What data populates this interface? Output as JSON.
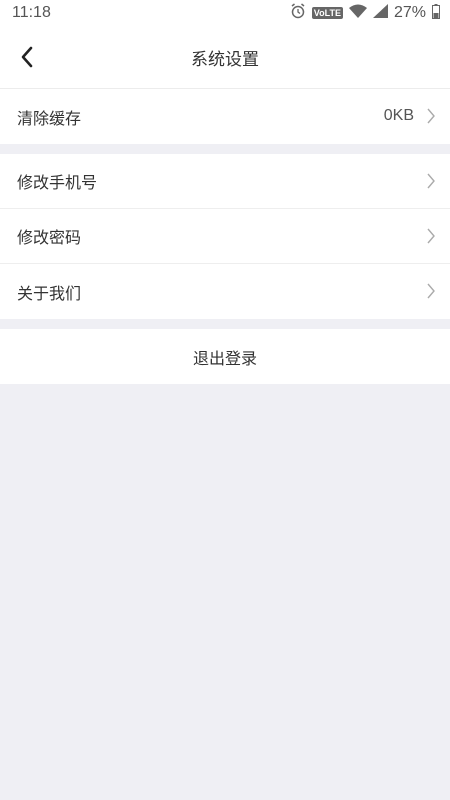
{
  "status_bar": {
    "time": "11:18",
    "network": "VoLTE",
    "battery": "27%",
    "icons": [
      "alarm-icon",
      "volte-icon",
      "wifi-icon",
      "signal-icon",
      "battery-icon"
    ]
  },
  "header": {
    "title": "系统设置",
    "back_icon": "chevron-left-icon"
  },
  "cache": {
    "label": "清除缓存",
    "value": "0KB"
  },
  "account_items": [
    {
      "label": "修改手机号"
    },
    {
      "label": "修改密码"
    },
    {
      "label": "关于我们"
    }
  ],
  "logout": {
    "label": "退出登录"
  },
  "colors": {
    "background": "#efeff4",
    "surface": "#ffffff",
    "text": "#333333",
    "chevron": "#aaaaaa"
  }
}
